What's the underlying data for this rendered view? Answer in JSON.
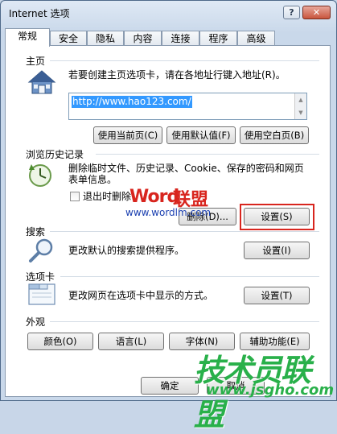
{
  "window": {
    "title": "Internet 选项",
    "help": "?",
    "close": "✕"
  },
  "tabs": [
    "常规",
    "安全",
    "隐私",
    "内容",
    "连接",
    "程序",
    "高级"
  ],
  "homepage": {
    "section": "主页",
    "desc": "若要创建主页选项卡，请在各地址行键入地址(R)。",
    "url": "http://www.hao123.com/",
    "btn_current": "使用当前页(C)",
    "btn_default": "使用默认值(F)",
    "btn_blank": "使用空白页(B)"
  },
  "history": {
    "section": "浏览历史记录",
    "desc_line1": "删除临时文件、历史记录、Cookie、保存的密码和网页",
    "desc_line2": "表单信息。",
    "checkbox_label": "退出时删除",
    "btn_delete": "删除(D)...",
    "btn_settings": "设置(S)"
  },
  "search": {
    "section": "搜索",
    "desc": "更改默认的搜索提供程序。",
    "btn_settings": "设置(I)"
  },
  "tabs_section": {
    "section": "选项卡",
    "desc": "更改网页在选项卡中显示的方式。",
    "btn_settings": "设置(T)"
  },
  "appearance": {
    "section": "外观",
    "btn_colors": "颜色(O)",
    "btn_languages": "语言(L)",
    "btn_fonts": "字体(N)",
    "btn_accessibility": "辅助功能(E)"
  },
  "bottom": {
    "btn_ok": "确定",
    "btn_cancel": "取消"
  },
  "watermarks": {
    "wordlm_logo": "Word",
    "wordlm_lianmeng": "联盟",
    "wordlm_url": "www.wordlm.com",
    "jsgho_title": "技术员联盟",
    "jsgho_url": "www.jsgho.com"
  },
  "colors": {
    "highlight": "#d8251e",
    "url_selection": "#3399ff"
  }
}
